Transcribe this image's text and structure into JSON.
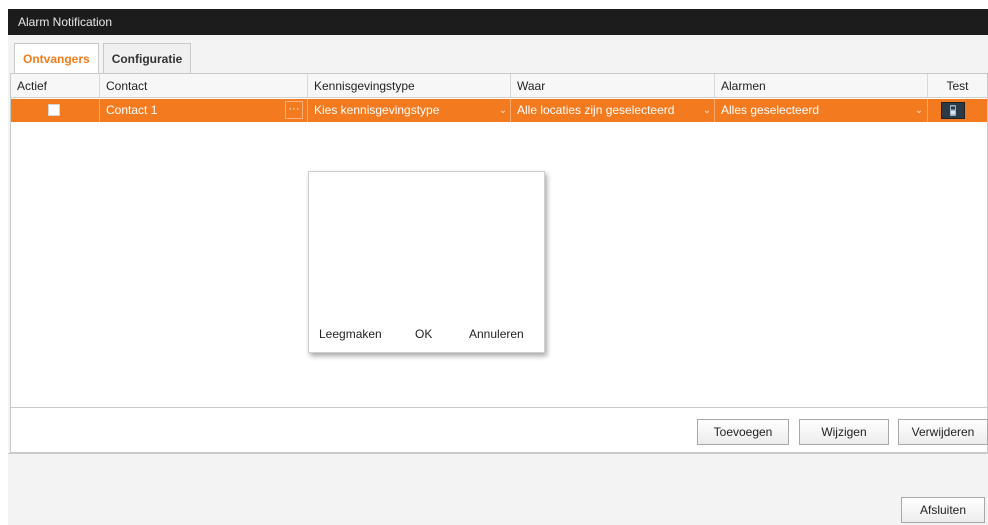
{
  "window": {
    "title": "Alarm Notification"
  },
  "tabs": [
    {
      "label": "Ontvangers",
      "active": true
    },
    {
      "label": "Configuratie",
      "active": false
    }
  ],
  "grid": {
    "columns": [
      "Actief",
      "Contact",
      "Kennisgevingstype",
      "Waar",
      "Alarmen",
      "Test"
    ],
    "rows": [
      {
        "active": false,
        "contact": "Contact 1",
        "notification_type": "Kies kennisgevingstype",
        "where": "Alle locaties zijn geselecteerd",
        "alarms": "Alles geselecteerd"
      }
    ],
    "ellipsis_label": "···",
    "dropdown_chevron": "⌄"
  },
  "popup": {
    "clear_label": "Leegmaken",
    "ok_label": "OK",
    "cancel_label": "Annuleren"
  },
  "actions": {
    "add_label": "Toevoegen",
    "edit_label": "Wijzigen",
    "delete_label": "Verwijderen",
    "close_label": "Afsluiten"
  },
  "colors": {
    "selection": "#f47a20",
    "active_tab_text": "#f07d1c",
    "titlebar": "#1c1c1c"
  },
  "icons": {
    "test": "phone-icon"
  }
}
